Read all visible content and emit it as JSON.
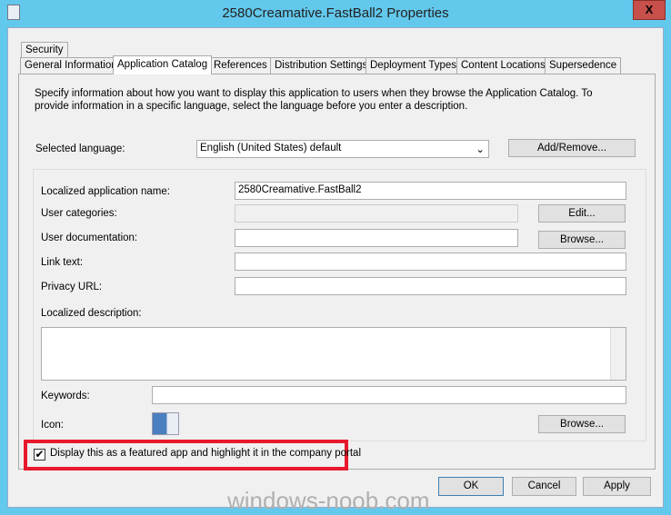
{
  "window": {
    "title": "2580Creamative.FastBall2 Properties",
    "close": "X"
  },
  "tabs": [
    {
      "label": "Security"
    },
    {
      "label": "General Information"
    },
    {
      "label": "Application Catalog"
    },
    {
      "label": "References"
    },
    {
      "label": "Distribution Settings"
    },
    {
      "label": "Deployment Types"
    },
    {
      "label": "Content Locations"
    },
    {
      "label": "Supersedence"
    }
  ],
  "intro": "Specify information about how you want to display this application to users when they browse the Application Catalog. To provide information in a specific language, select the language before you enter a description.",
  "language": {
    "label": "Selected language:",
    "value": "English (United States) default",
    "add_remove": "Add/Remove..."
  },
  "fields": {
    "app_name_label": "Localized application name:",
    "app_name_value": "2580Creamative.FastBall2",
    "categories_label": "User categories:",
    "edit": "Edit...",
    "doc_label": "User documentation:",
    "browse": "Browse...",
    "link_label": "Link text:",
    "privacy_label": "Privacy URL:",
    "desc_label": "Localized description:",
    "keywords_label": "Keywords:",
    "icon_label": "Icon:",
    "icon_browse": "Browse..."
  },
  "featured": {
    "label": "Display this as a featured app and highlight it in the company portal",
    "checked": true,
    "highlight_color": "#e8192c"
  },
  "buttons": {
    "ok": "OK",
    "cancel": "Cancel",
    "apply": "Apply"
  },
  "watermark": "windows-noob.com"
}
